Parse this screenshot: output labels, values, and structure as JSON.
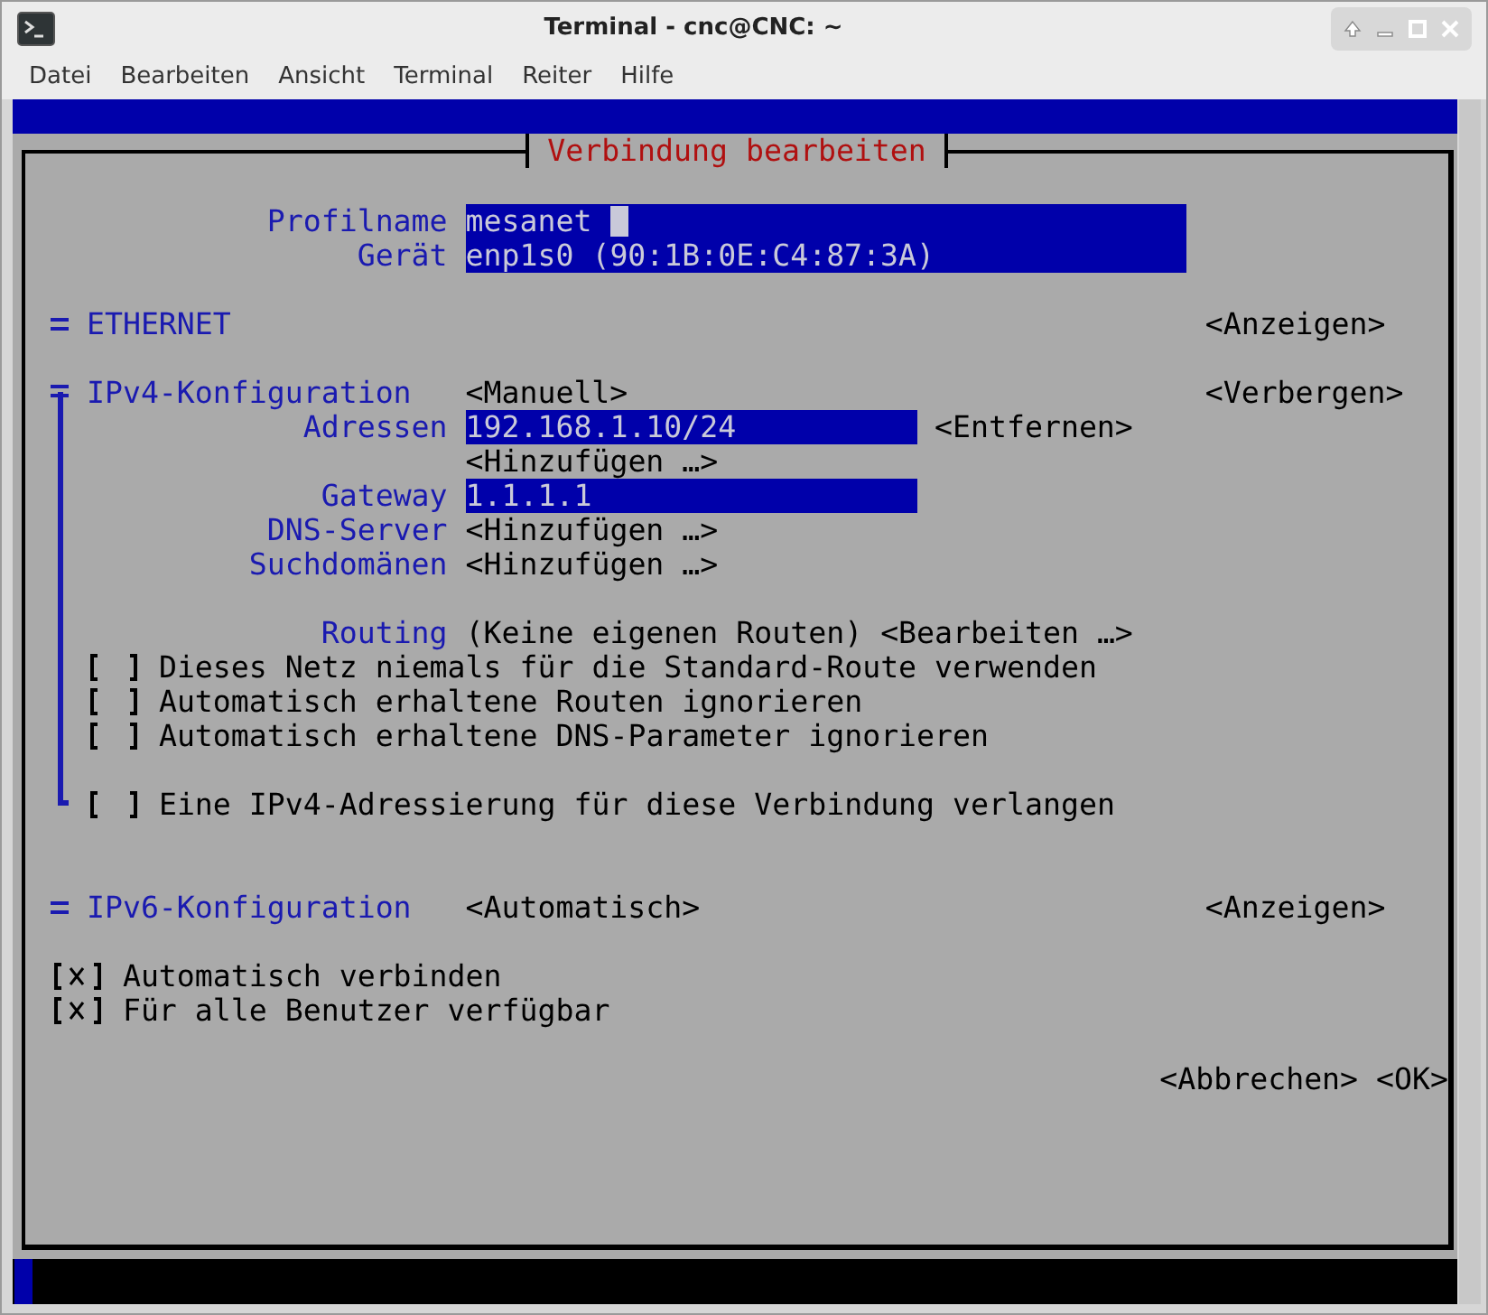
{
  "window": {
    "title": "Terminal - cnc@CNC: ~"
  },
  "menu": [
    "Datei",
    "Bearbeiten",
    "Ansicht",
    "Terminal",
    "Reiter",
    "Hilfe"
  ],
  "dialog": {
    "title": "Verbindung bearbeiten",
    "profile": [
      {
        "label": "Profilname",
        "value": "mesanet",
        "focused": true
      },
      {
        "label": "Gerät",
        "value": "enp1s0 (90:1B:0E:C4:87:3A)",
        "focused": false
      }
    ],
    "sections": [
      {
        "title": "ETHERNET",
        "toggle": "<Anzeigen>",
        "expanded": false
      },
      {
        "title": "IPv4-Konfiguration",
        "method": "<Manuell>",
        "toggle": "<Verbergen>",
        "expanded": true,
        "rows": [
          {
            "kind": "input",
            "spaced": false,
            "label": "Adressen",
            "value": "192.168.1.10/24",
            "action": "<Entfernen>"
          },
          {
            "kind": "add",
            "spaced": false,
            "button": "<Hinzufügen …>"
          },
          {
            "kind": "input",
            "spaced": false,
            "label": "Gateway",
            "value": "1.1.1.1"
          },
          {
            "kind": "add",
            "spaced": false,
            "label": "DNS-Server",
            "button": "<Hinzufügen …>"
          },
          {
            "kind": "add",
            "spaced": false,
            "label": "Suchdomänen",
            "button": "<Hinzufügen …>"
          },
          {
            "kind": "routing",
            "spaced": true,
            "label": "Routing",
            "text": "(Keine eigenen Routen)",
            "button": "<Bearbeiten …>"
          },
          {
            "kind": "checkbox",
            "spaced": false,
            "checked": false,
            "text": "Dieses Netz niemals für die Standard-Route verwenden"
          },
          {
            "kind": "checkbox",
            "spaced": false,
            "checked": false,
            "text": "Automatisch erhaltene Routen ignorieren"
          },
          {
            "kind": "checkbox",
            "spaced": false,
            "checked": false,
            "text": "Automatisch erhaltene DNS-Parameter ignorieren"
          },
          {
            "kind": "checkbox",
            "spaced": true,
            "checked": false,
            "text": "Eine IPv4-Adressierung für diese Verbindung verlangen"
          }
        ]
      },
      {
        "title": "IPv6-Konfiguration",
        "method": "<Automatisch>",
        "toggle": "<Anzeigen>",
        "expanded": false
      }
    ],
    "options": [
      {
        "checked": true,
        "text": "Automatisch verbinden"
      },
      {
        "checked": true,
        "text": "Für alle Benutzer verfügbar"
      }
    ],
    "buttons": [
      "<Abbrechen>",
      "<OK>"
    ]
  }
}
